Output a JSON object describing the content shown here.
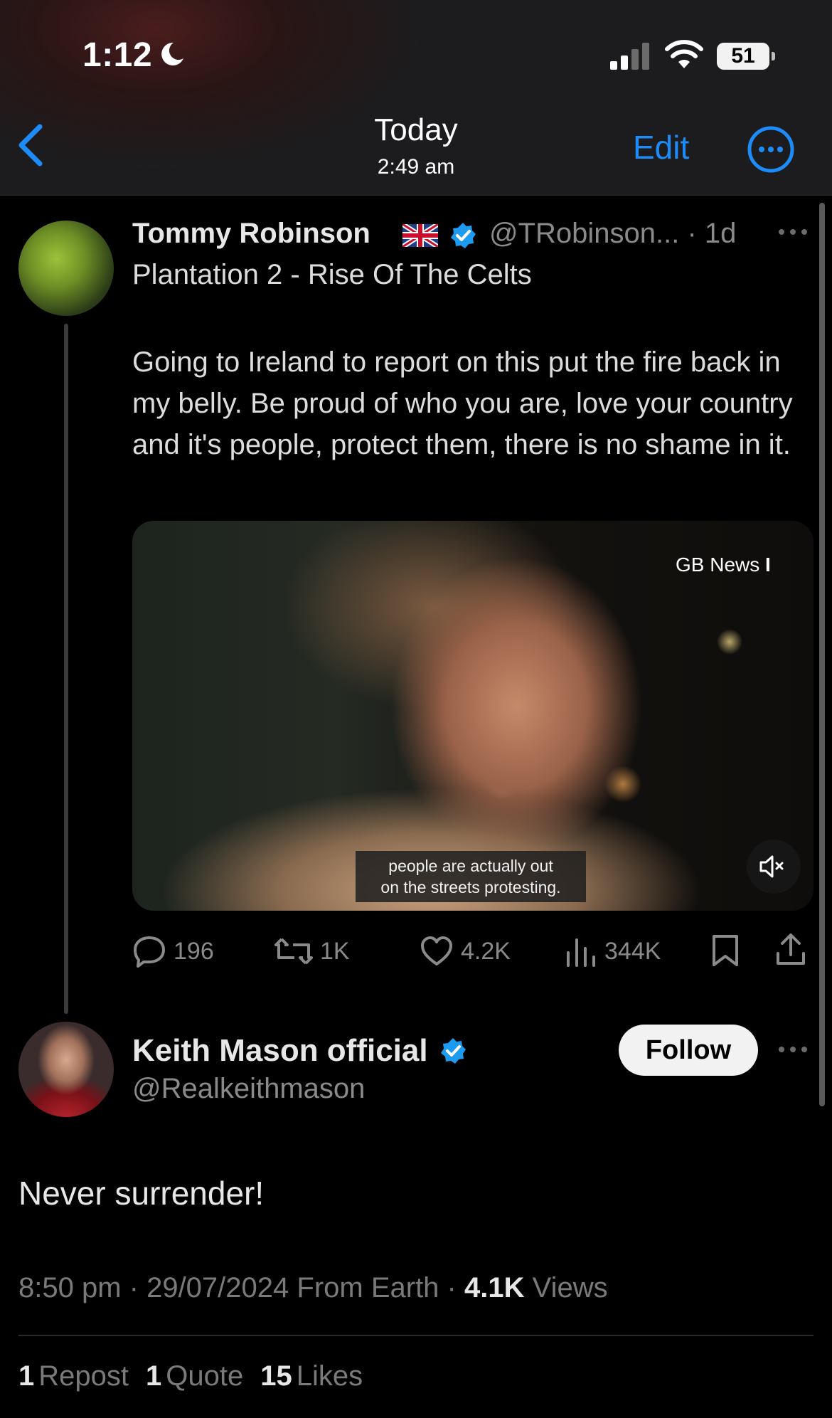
{
  "status_bar": {
    "time": "1:12",
    "battery": "51"
  },
  "nav": {
    "title": "Today",
    "subtitle": "2:49 am",
    "edit_label": "Edit"
  },
  "tweet": {
    "author_name": "Tommy Robinson",
    "handle_time": "@TRobinson... · 1d",
    "headline": "Plantation 2 - Rise Of The Celts",
    "body": "Going to Ireland to report on this put the fire back in my belly. Be proud of who you are, love your country and it's people, protect them, there is no shame in it.",
    "video": {
      "watermark": "GB News",
      "caption_line1": "people are actually out",
      "caption_line2": "on the streets protesting."
    },
    "actions": {
      "replies": "196",
      "reposts": "1K",
      "likes": "4.2K",
      "views": "344K"
    }
  },
  "reply": {
    "author_name": "Keith Mason official",
    "handle": "@Realkeithmason",
    "follow_label": "Follow",
    "body": "Never surrender!",
    "meta_prefix": "8:50 pm · 29/07/2024 From Earth · ",
    "views_count": "4.1K",
    "views_label": "Views",
    "repost_count": "1",
    "repost_label": "Repost",
    "quote_count": "1",
    "quote_label": "Quote",
    "likes_count": "15",
    "likes_label": "Likes"
  },
  "colors": {
    "accent": "#1d8cf8",
    "verified": "#1d9bf0"
  }
}
